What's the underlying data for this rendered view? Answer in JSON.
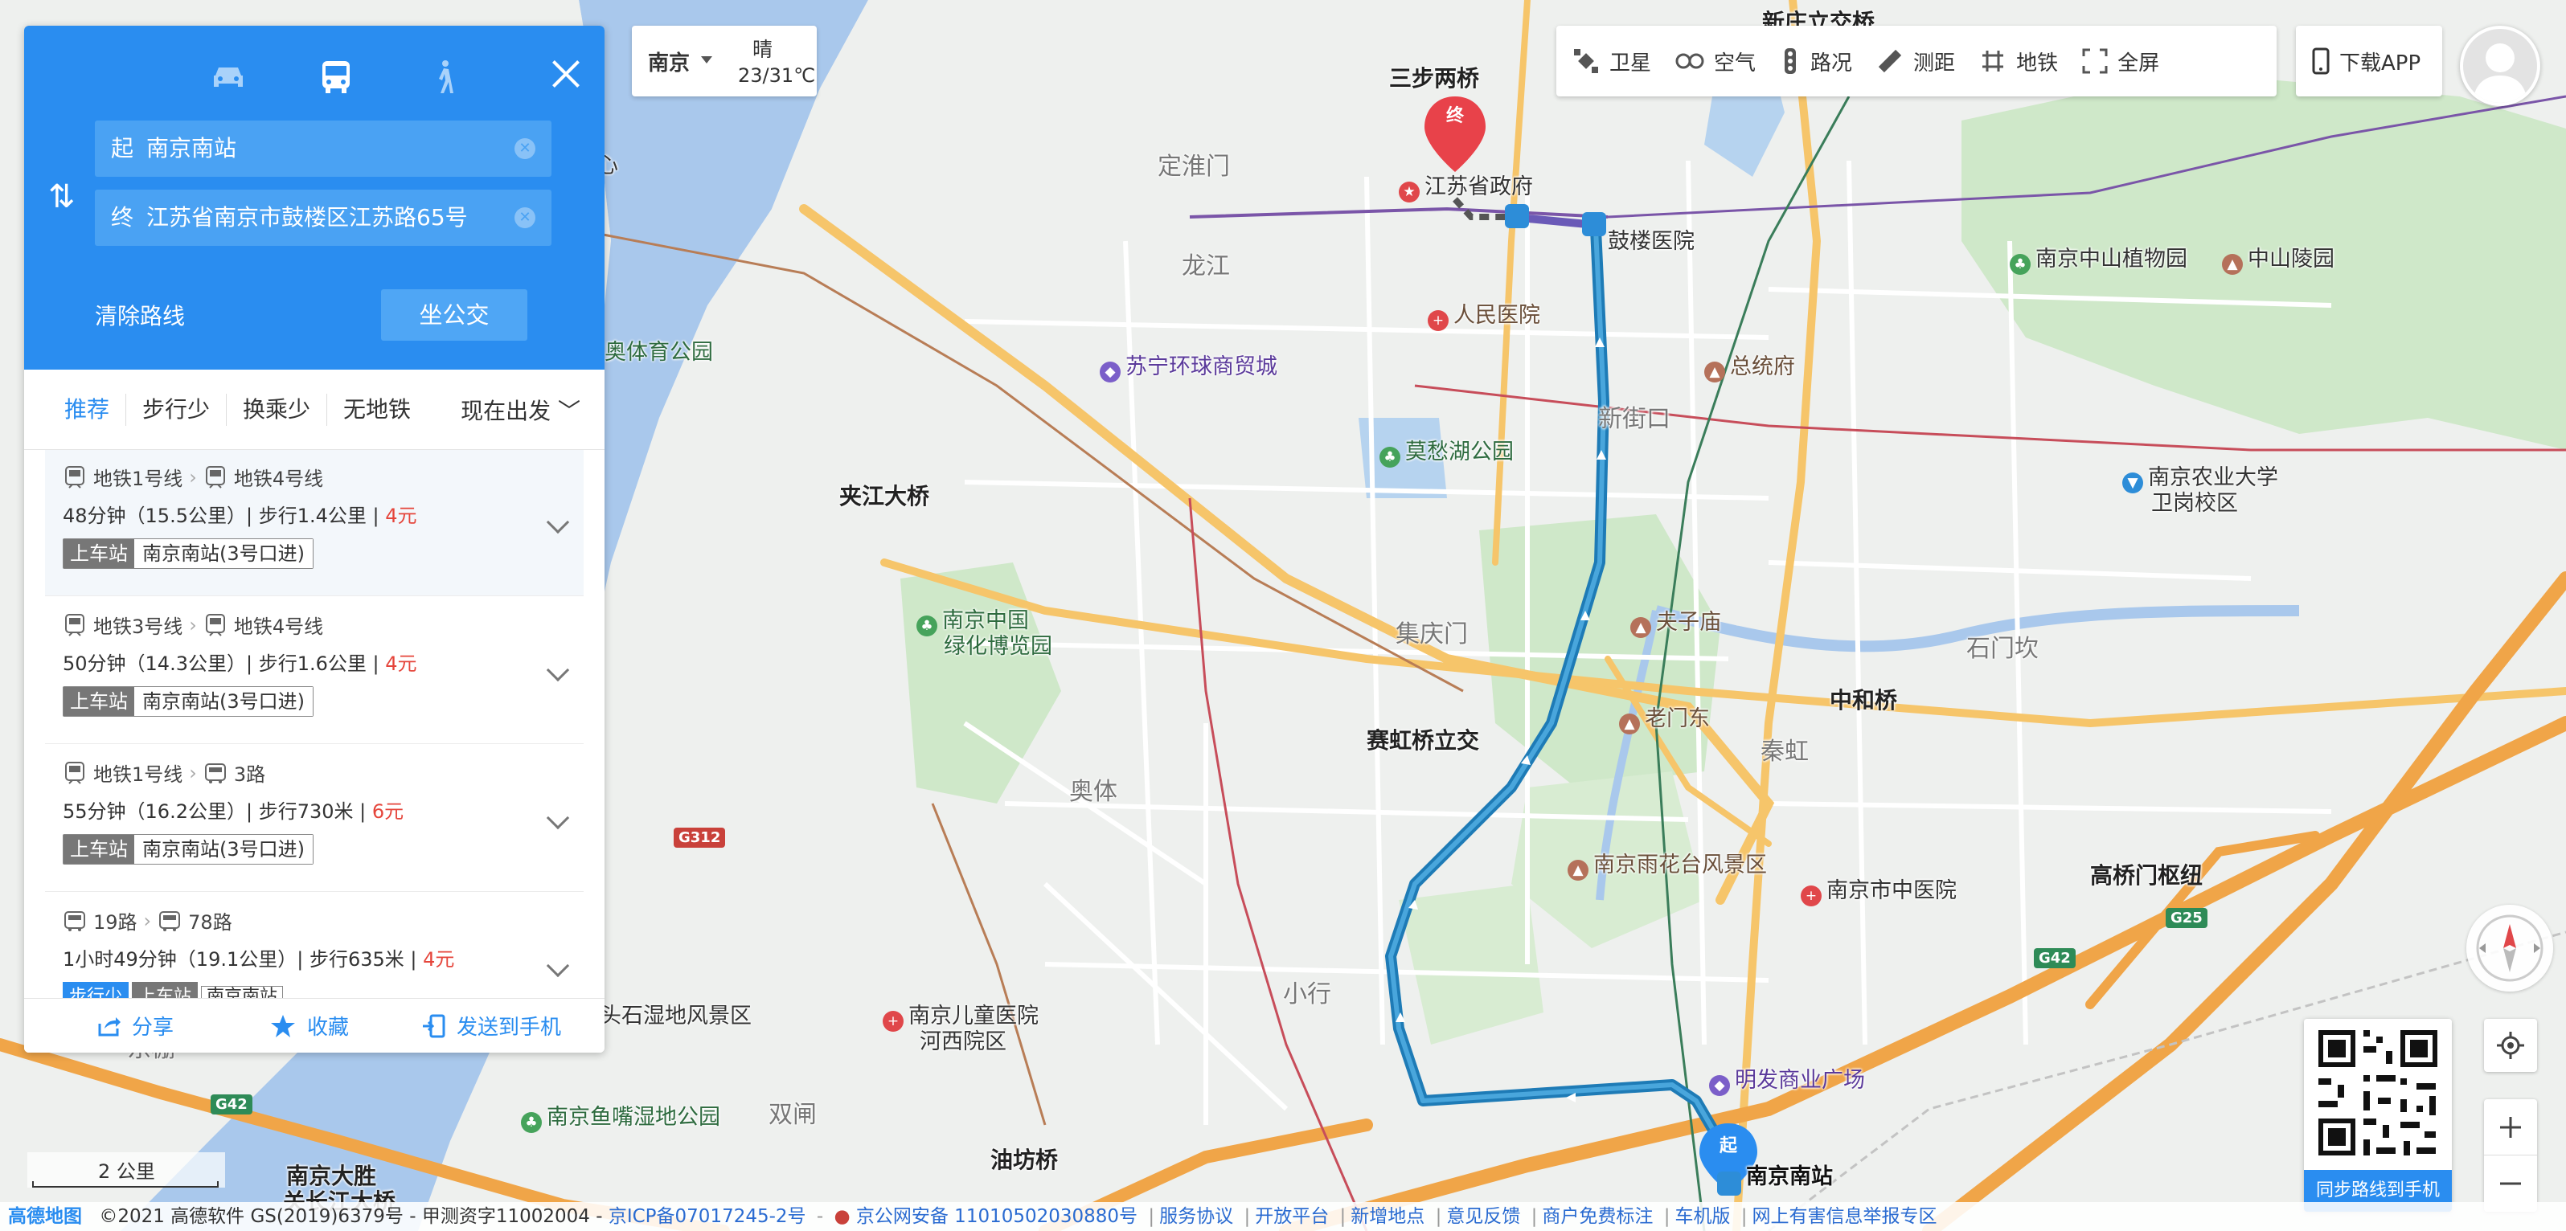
{
  "route_panel": {
    "modes": [
      "car-icon",
      "bus-icon",
      "walk-icon"
    ],
    "start_tag": "起",
    "start_value": "南京南站",
    "end_tag": "终",
    "end_value": "江苏省南京市鼓楼区江苏路65号",
    "clear_label": "清除路线",
    "search_button": "坐公交",
    "tabs": [
      "推荐",
      "步行少",
      "换乘少",
      "无地铁"
    ],
    "depart": "现在出发",
    "plans": [
      {
        "legs": [
          "地铁1号线",
          "地铁4号线"
        ],
        "info": "48分钟（15.5公里）| 步行1.4公里 |",
        "price": "4元",
        "board_label": "上车站",
        "board_station": "南京南站(3号口进)"
      },
      {
        "legs": [
          "地铁3号线",
          "地铁4号线"
        ],
        "info": "50分钟（14.3公里）| 步行1.6公里 |",
        "price": "4元",
        "board_label": "上车站",
        "board_station": "南京南站(3号口进)"
      },
      {
        "legs": [
          "地铁1号线",
          "3路"
        ],
        "info": "55分钟（16.2公里）| 步行730米 |",
        "price": "6元",
        "board_label": "上车站",
        "board_station": "南京南站(3号口进)"
      },
      {
        "legs": [
          "19路",
          "78路"
        ],
        "info": "1小时49分钟（19.1公里）| 步行635米 |",
        "price": "4元",
        "badges": [
          "步行少",
          "上车站",
          "南京南站"
        ]
      }
    ],
    "actions": [
      "分享",
      "收藏",
      "发送到手机"
    ]
  },
  "weather": {
    "city": "南京",
    "condition": "晴",
    "temp": "23/31℃"
  },
  "toolbar": {
    "items": [
      "卫星",
      "空气",
      "路况",
      "测距",
      "地铁",
      "全屏"
    ],
    "download": "下载APP"
  },
  "qr": {
    "caption": "同步路线到手机"
  },
  "scale": {
    "label": "2 公里"
  },
  "map_labels": {
    "xinzhuang": "新庄立交桥",
    "sanbu": "三步两桥",
    "dinghuai": "定淮门",
    "jiangsu_gov": "江苏省政府",
    "gulou_hosp": "鼓楼医院",
    "longjiang": "龙江",
    "renmin": "人民医院",
    "suning": "苏宁环球商贸城",
    "zongtongfu": "总统府",
    "xinjiekou": "新街口",
    "mochou": "莫愁湖公园",
    "jiajiang": "夹江大桥",
    "aoti_sports": "奥体育公园",
    "zhongshan_bot": "南京中山植物园",
    "zhongshan_ling": "中山陵园",
    "agri_univ_1": "南京农业大学",
    "agri_univ_2": "卫岗校区",
    "greenexpo_1": "南京中国",
    "greenexpo_2": "绿化博览园",
    "jiqingmen": "集庆门",
    "fuzimiao": "夫子庙",
    "shiguankan": "石门坎",
    "zhongheqiao": "中和桥",
    "laomendong": "老门东",
    "saihong": "赛虹桥立交",
    "aoti": "奥体",
    "qinhong": "秦虹",
    "yuhuatai": "南京雨花台风景区",
    "tcm": "南京市中医院",
    "gaoqiaomen": "高桥门枢纽",
    "xiaoxing": "小行",
    "wetland": "头石湿地风景区",
    "child_hosp_1": "南京儿童医院",
    "child_hosp_2": "河西院区",
    "mingfa": "明发商业广场",
    "dongpeng": "东棚",
    "shuangzha": "双闸",
    "yuzui": "南京鱼嘴湿地公园",
    "dasheng_1": "南京大胜",
    "dasheng_2": "关长江大桥",
    "youfangqiao": "油坊桥",
    "nanjing_south": "南京南站",
    "xin": "心",
    "g312": "G312",
    "g42a": "G42",
    "g42b": "G42",
    "g25": "G25",
    "end_marker": "终",
    "start_marker": "起"
  },
  "footer": {
    "logo": "高德地图",
    "copyright": "©2021 高德软件 GS(2019)6379号 - 甲测资字11002004 -",
    "icp": "京ICP备07017245-2号",
    "police": "京公网安备 11010502030880号",
    "links": [
      "服务协议",
      "开放平台",
      "新增地点",
      "意见反馈",
      "商户免费标注",
      "车机版",
      "网上有害信息举报专区"
    ]
  }
}
